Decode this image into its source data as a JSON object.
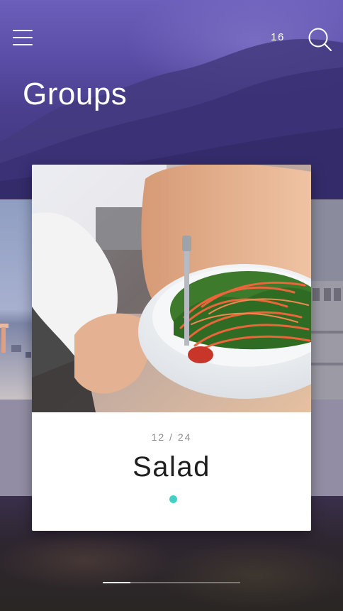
{
  "header": {
    "menu_icon": "hamburger-menu-icon",
    "count": "16",
    "search_icon": "search-icon",
    "title": "Groups"
  },
  "card": {
    "counter": "12 / 24",
    "title": "Salad",
    "indicator_color": "#3fd1c2"
  },
  "pager": {
    "current": 12,
    "total": 24,
    "progress": 0.2
  },
  "colors": {
    "header_overlay": "#5a4ea8",
    "accent": "#3fd1c2",
    "card_background": "#ffffff",
    "title_text": "#1e1e1e",
    "counter_text": "#8c8c8c"
  }
}
